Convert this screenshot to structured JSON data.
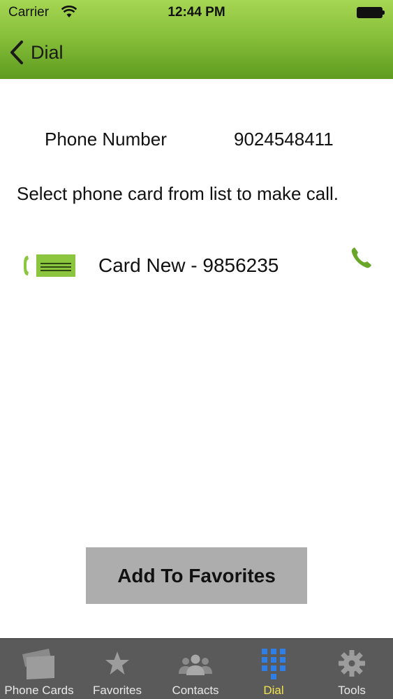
{
  "status_bar": {
    "carrier": "Carrier",
    "time": "12:44 PM",
    "wifi_icon": "wifi-icon",
    "battery_icon": "battery-icon"
  },
  "nav": {
    "back_label": "Dial",
    "back_icon": "chevron-left-icon"
  },
  "phone": {
    "label": "Phone Number",
    "value": "9024548411"
  },
  "instruction": "Select phone card from list to make call.",
  "cards": [
    {
      "label": "Card New - 9856235",
      "icon": "phone-card-icon",
      "action_icon": "phone-call-icon"
    }
  ],
  "favorites_button": {
    "label": "Add To Favorites"
  },
  "tab_bar": {
    "tabs": [
      {
        "label": "Phone Cards",
        "icon": "cards-icon",
        "active": false
      },
      {
        "label": "Favorites",
        "icon": "star-icon",
        "active": false
      },
      {
        "label": "Contacts",
        "icon": "people-icon",
        "active": false
      },
      {
        "label": "Dial",
        "icon": "keypad-icon",
        "active": true
      },
      {
        "label": "Tools",
        "icon": "gear-icon",
        "active": false
      }
    ]
  },
  "colors": {
    "header_green": "#7cb832",
    "accent_green": "#8cc63f",
    "tab_bar_bg": "#5a5a5a",
    "active_tab": "#f3e34f",
    "keypad_blue": "#2f7fe8",
    "button_gray": "#adadad"
  }
}
